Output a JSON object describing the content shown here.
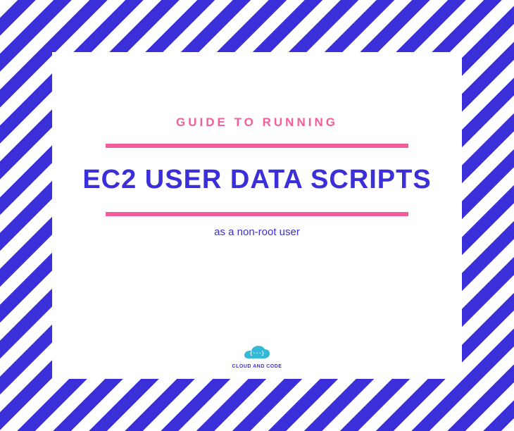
{
  "eyebrow": "GUIDE TO RUNNING",
  "title": "EC2 USER DATA SCRIPTS",
  "subtitle": "as a non-root user",
  "logo": {
    "text": "CLOUD AND CODE",
    "glyph": "{ ··· }"
  },
  "colors": {
    "accent_pink": "#f35e9a",
    "accent_blue": "#3a2fd9",
    "logo_cyan": "#35b8d6"
  }
}
